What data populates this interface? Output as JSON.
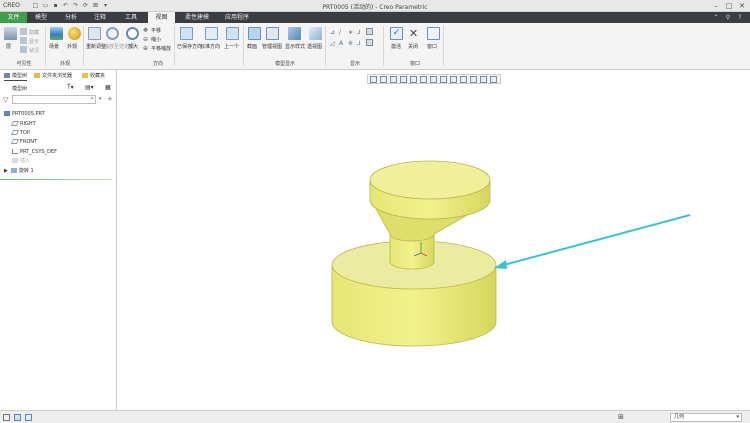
{
  "titlebar": {
    "app": "CREO",
    "title": "PRT0005 (活动的) - Creo Parametric"
  },
  "tabs": [
    {
      "label": "文件"
    },
    {
      "label": "模型"
    },
    {
      "label": "分析"
    },
    {
      "label": "注释"
    },
    {
      "label": "工具"
    },
    {
      "label": "视图"
    },
    {
      "label": "柔性建模"
    },
    {
      "label": "应用程序"
    }
  ],
  "ribbon": {
    "visibility": {
      "group_label": "可见性",
      "items": [
        "隐藏",
        "显示",
        "状况"
      ],
      "layer_label": "层"
    },
    "appearance": {
      "group_label": "外观",
      "items": [
        "场景",
        "外观"
      ]
    },
    "orientation": {
      "group_label": "方向",
      "refit": "重新调整",
      "zoom_in": "放大",
      "zoom_out_label": "缩小",
      "pan": "平移",
      "pan_zoom": "平移缩放",
      "zoom_area": "缩放至选定项"
    },
    "model_display": {
      "group_label": "模型显示",
      "saved_orient": "已保存方向",
      "std_orient": "标准方向",
      "prev": "上一个",
      "section": "截面",
      "manage_views": "管理视图",
      "display_style": "显示样式",
      "perspective": "透视图"
    },
    "show": {
      "group_label": "显示"
    },
    "window": {
      "group_label": "窗口",
      "activate": "激活",
      "close": "关闭",
      "window": "窗口"
    }
  },
  "leftpanel": {
    "tabs": [
      "模型树",
      "文件夹浏览器",
      "收藏夹"
    ],
    "tree_title": "模型树",
    "tree": [
      {
        "label": "PRT0005.PRT",
        "dim": false
      },
      {
        "label": "RIGHT",
        "dim": false
      },
      {
        "label": "TOP",
        "dim": false
      },
      {
        "label": "FRONT",
        "dim": false
      },
      {
        "label": "PRT_CSYS_DEF",
        "dim": false
      },
      {
        "label": "插入",
        "dim": true
      },
      {
        "label": "旋转 1",
        "dim": false
      }
    ]
  },
  "statusbar": {
    "filter_value": "几何"
  },
  "colors": {
    "tabbar": "#3a3d42",
    "file_tab": "#3f9d4b",
    "model_yellow": "#e8e87a",
    "arrow": "#36c4d0"
  }
}
